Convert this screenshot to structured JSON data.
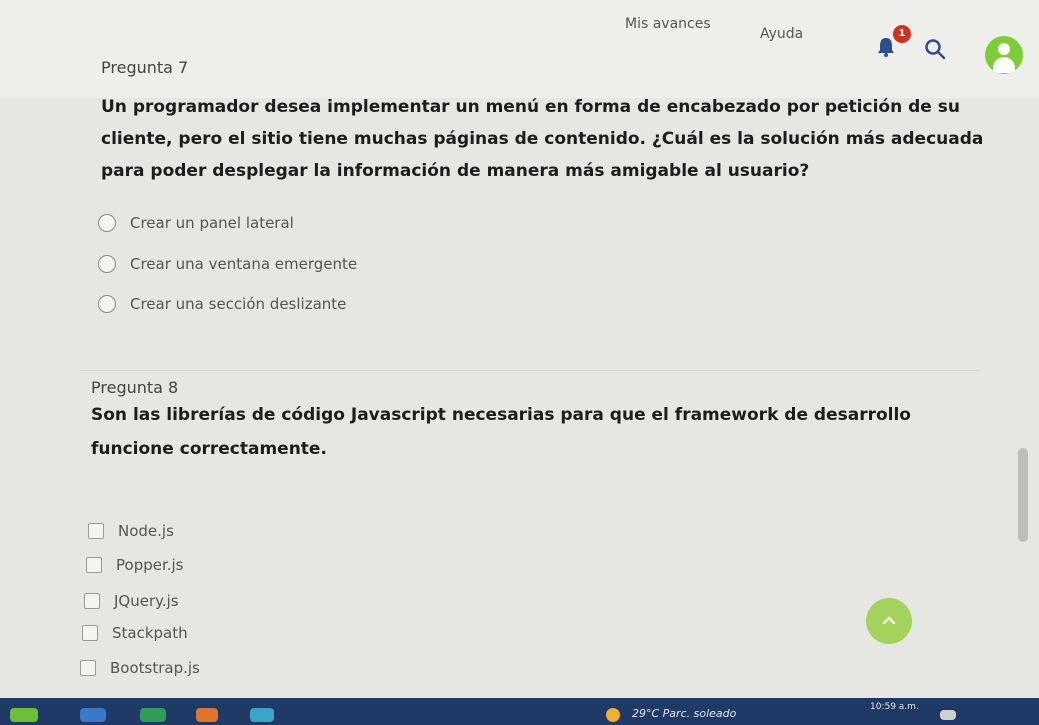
{
  "nav": {
    "progress": "Mis avances",
    "help": "Ayuda",
    "notification_count": "1"
  },
  "questions": [
    {
      "label": "Pregunta 7",
      "text_lines": [
        "Un programador desea implementar un menú en forma de encabezado por petición de su",
        "cliente, pero el sitio tiene muchas páginas de contenido. ¿Cuál es la solución más adecuada",
        "para poder desplegar la información de manera más amigable al usuario?"
      ],
      "options": [
        "Crear un panel lateral",
        "Crear una ventana emergente",
        "Crear una sección deslizante"
      ]
    },
    {
      "label": "Pregunta 8",
      "text_lines": [
        "Son las librerías de código Javascript necesarias para que el framework de desarrollo",
        "funcione correctamente."
      ],
      "options": [
        "Node.js",
        "Popper.js",
        "JQuery.js",
        "Stackpath",
        "Bootstrap.js"
      ]
    }
  ],
  "taskbar": {
    "weather": "29°C  Parc. soleado",
    "clock": "10:59 a.m."
  },
  "colors": {
    "accent_green": "#7fcc3a",
    "badge_red": "#cc3322",
    "taskbar": "#1f3a66"
  }
}
